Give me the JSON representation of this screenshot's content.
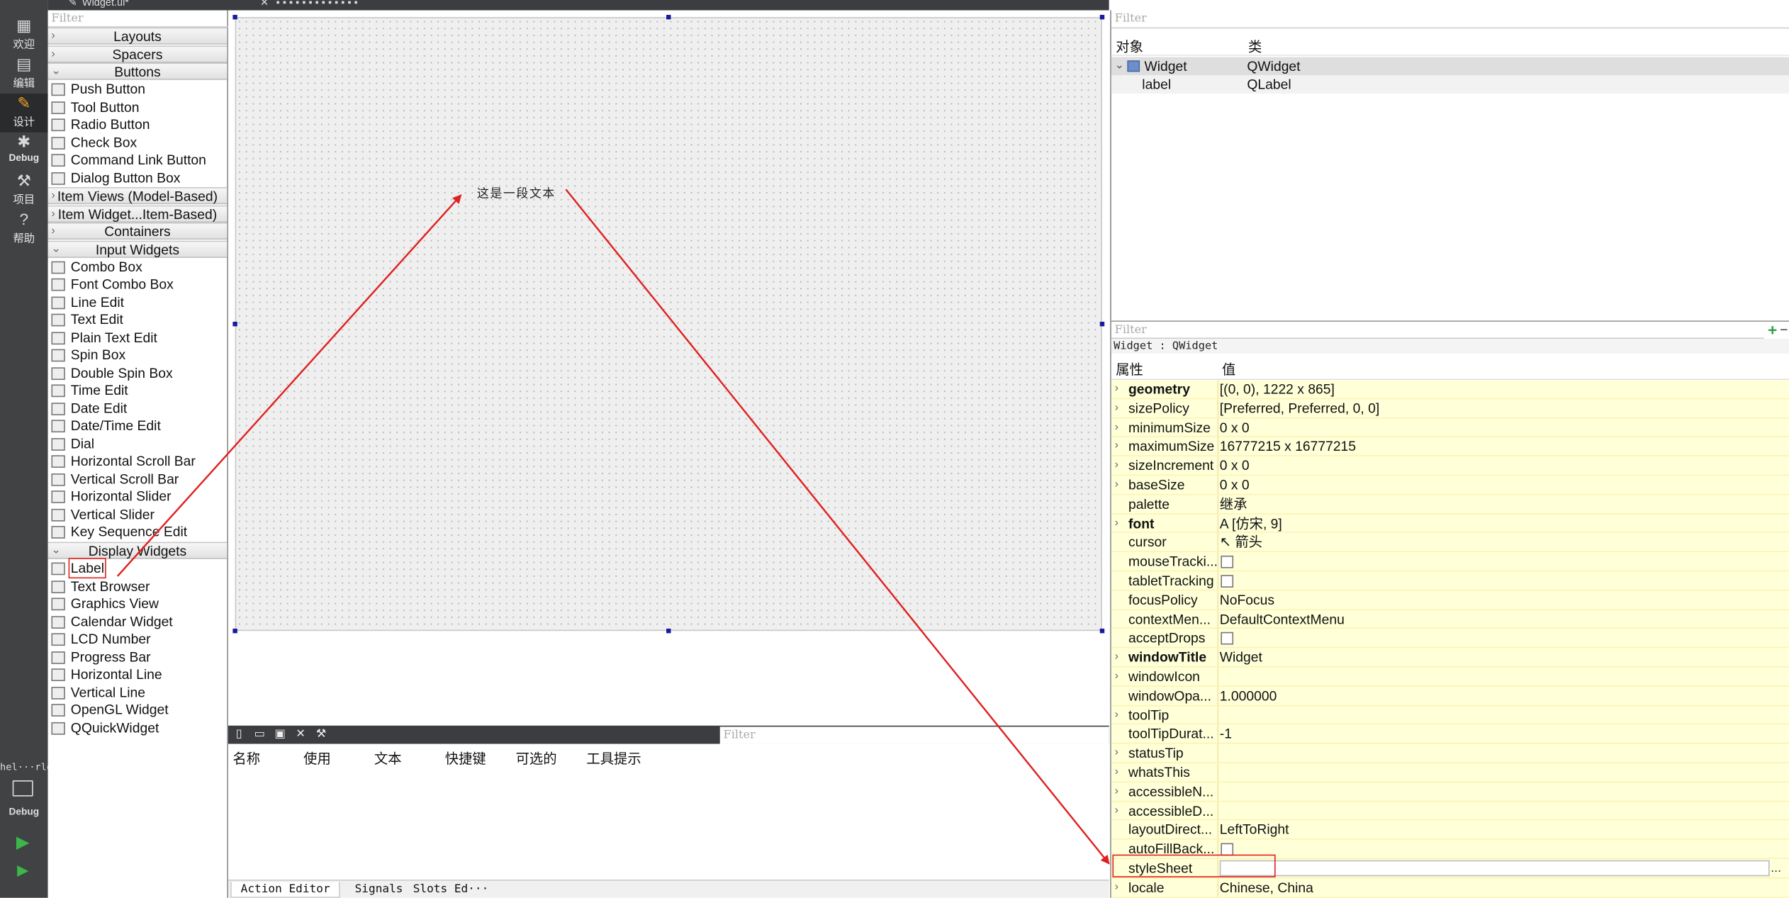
{
  "modebar": {
    "items": [
      {
        "icon": "grid-icon",
        "label": "欢迎"
      },
      {
        "icon": "edit-icon",
        "label": "编辑"
      },
      {
        "icon": "design-icon",
        "label": "设计"
      },
      {
        "icon": "debug-icon",
        "label": "Debug"
      },
      {
        "icon": "wrench-icon",
        "label": "项目"
      },
      {
        "icon": "help-icon",
        "label": "帮助"
      }
    ],
    "active_index": 2,
    "kit_name": "hel···rld",
    "kit_mode": "Debug"
  },
  "toolbar": {
    "file_tab": "Widget.ui*"
  },
  "widget_box": {
    "filter_placeholder": "Filter",
    "categories": {
      "layouts": "Layouts",
      "spacers": "Spacers",
      "buttons": "Buttons",
      "item_views": "Item Views (Model-Based)",
      "item_widgets": "Item Widget...Item-Based)",
      "containers": "Containers",
      "input_widgets": "Input Widgets",
      "display_widgets": "Display Widgets"
    },
    "buttons": [
      "Push Button",
      "Tool Button",
      "Radio Button",
      "Check Box",
      "Command Link Button",
      "Dialog Button Box"
    ],
    "input_widgets": [
      "Combo Box",
      "Font Combo Box",
      "Line Edit",
      "Text Edit",
      "Plain Text Edit",
      "Spin Box",
      "Double Spin Box",
      "Time Edit",
      "Date Edit",
      "Date/Time Edit",
      "Dial",
      "Horizontal Scroll Bar",
      "Vertical Scroll Bar",
      "Horizontal Slider",
      "Vertical Slider",
      "Key Sequence Edit"
    ],
    "display_widgets": [
      "Label",
      "Text Browser",
      "Graphics View",
      "Calendar Widget",
      "LCD Number",
      "Progress Bar",
      "Horizontal Line",
      "Vertical Line",
      "OpenGL Widget",
      "QQuickWidget"
    ],
    "highlighted": "Label"
  },
  "form": {
    "label_text": "这是一段文本"
  },
  "action_editor": {
    "filter_placeholder": "Filter",
    "columns": [
      "名称",
      "使用",
      "文本",
      "快捷键",
      "可选的",
      "工具提示"
    ],
    "tabs": [
      "Action Editor",
      "Signals",
      "Slots Ed···"
    ]
  },
  "object_inspector": {
    "filter_placeholder": "Filter",
    "columns": [
      "对象",
      "类"
    ],
    "rows": [
      {
        "object": "Widget",
        "class": "QWidget"
      },
      {
        "object": "label",
        "class": "QLabel"
      }
    ]
  },
  "property_editor": {
    "filter_placeholder": "Filter",
    "class_line": "Widget : QWidget",
    "columns": [
      "属性",
      "值"
    ],
    "properties": [
      {
        "name": "geometry",
        "value": "[(0, 0), 1222 x 865]",
        "bold": true,
        "expandable": true
      },
      {
        "name": "sizePolicy",
        "value": "[Preferred, Preferred, 0, 0]",
        "bold": false,
        "expandable": true
      },
      {
        "name": "minimumSize",
        "value": "0 x 0",
        "bold": false,
        "expandable": true
      },
      {
        "name": "maximumSize",
        "value": "16777215 x 16777215",
        "bold": false,
        "expandable": true
      },
      {
        "name": "sizeIncrement",
        "value": "0 x 0",
        "bold": false,
        "expandable": true
      },
      {
        "name": "baseSize",
        "value": "0 x 0",
        "bold": false,
        "expandable": true
      },
      {
        "name": "palette",
        "value": "继承",
        "bold": false,
        "expandable": false
      },
      {
        "name": "font",
        "value": "A  [仿宋, 9]",
        "bold": true,
        "expandable": true
      },
      {
        "name": "cursor",
        "value": "↖ 箭头",
        "bold": false,
        "expandable": false
      },
      {
        "name": "mouseTracki...",
        "value": "",
        "bold": false,
        "expandable": false,
        "checkbox": true
      },
      {
        "name": "tabletTracking",
        "value": "",
        "bold": false,
        "expandable": false,
        "checkbox": true
      },
      {
        "name": "focusPolicy",
        "value": "NoFocus",
        "bold": false,
        "expandable": false
      },
      {
        "name": "contextMen...",
        "value": "DefaultContextMenu",
        "bold": false,
        "expandable": false
      },
      {
        "name": "acceptDrops",
        "value": "",
        "bold": false,
        "expandable": false,
        "checkbox": true
      },
      {
        "name": "windowTitle",
        "value": "Widget",
        "bold": true,
        "expandable": true
      },
      {
        "name": "windowIcon",
        "value": "",
        "bold": false,
        "expandable": true
      },
      {
        "name": "windowOpa...",
        "value": "1.000000",
        "bold": false,
        "expandable": false
      },
      {
        "name": "toolTip",
        "value": "",
        "bold": false,
        "expandable": true
      },
      {
        "name": "toolTipDurat...",
        "value": "-1",
        "bold": false,
        "expandable": false
      },
      {
        "name": "statusTip",
        "value": "",
        "bold": false,
        "expandable": true
      },
      {
        "name": "whatsThis",
        "value": "",
        "bold": false,
        "expandable": true
      },
      {
        "name": "accessibleN...",
        "value": "",
        "bold": false,
        "expandable": true
      },
      {
        "name": "accessibleD...",
        "value": "",
        "bold": false,
        "expandable": true
      },
      {
        "name": "layoutDirect...",
        "value": "LeftToRight",
        "bold": false,
        "expandable": false
      },
      {
        "name": "autoFillBack...",
        "value": "",
        "bold": false,
        "expandable": false,
        "checkbox": true
      },
      {
        "name": "styleSheet",
        "value": "",
        "bold": false,
        "expandable": false,
        "editing": true,
        "dots": "..."
      },
      {
        "name": "locale",
        "value": "Chinese, China",
        "bold": false,
        "expandable": true
      }
    ]
  },
  "colors": {
    "annotation": "#e02020",
    "property_bg": "#ffffd8",
    "modebar_bg": "#404244"
  }
}
